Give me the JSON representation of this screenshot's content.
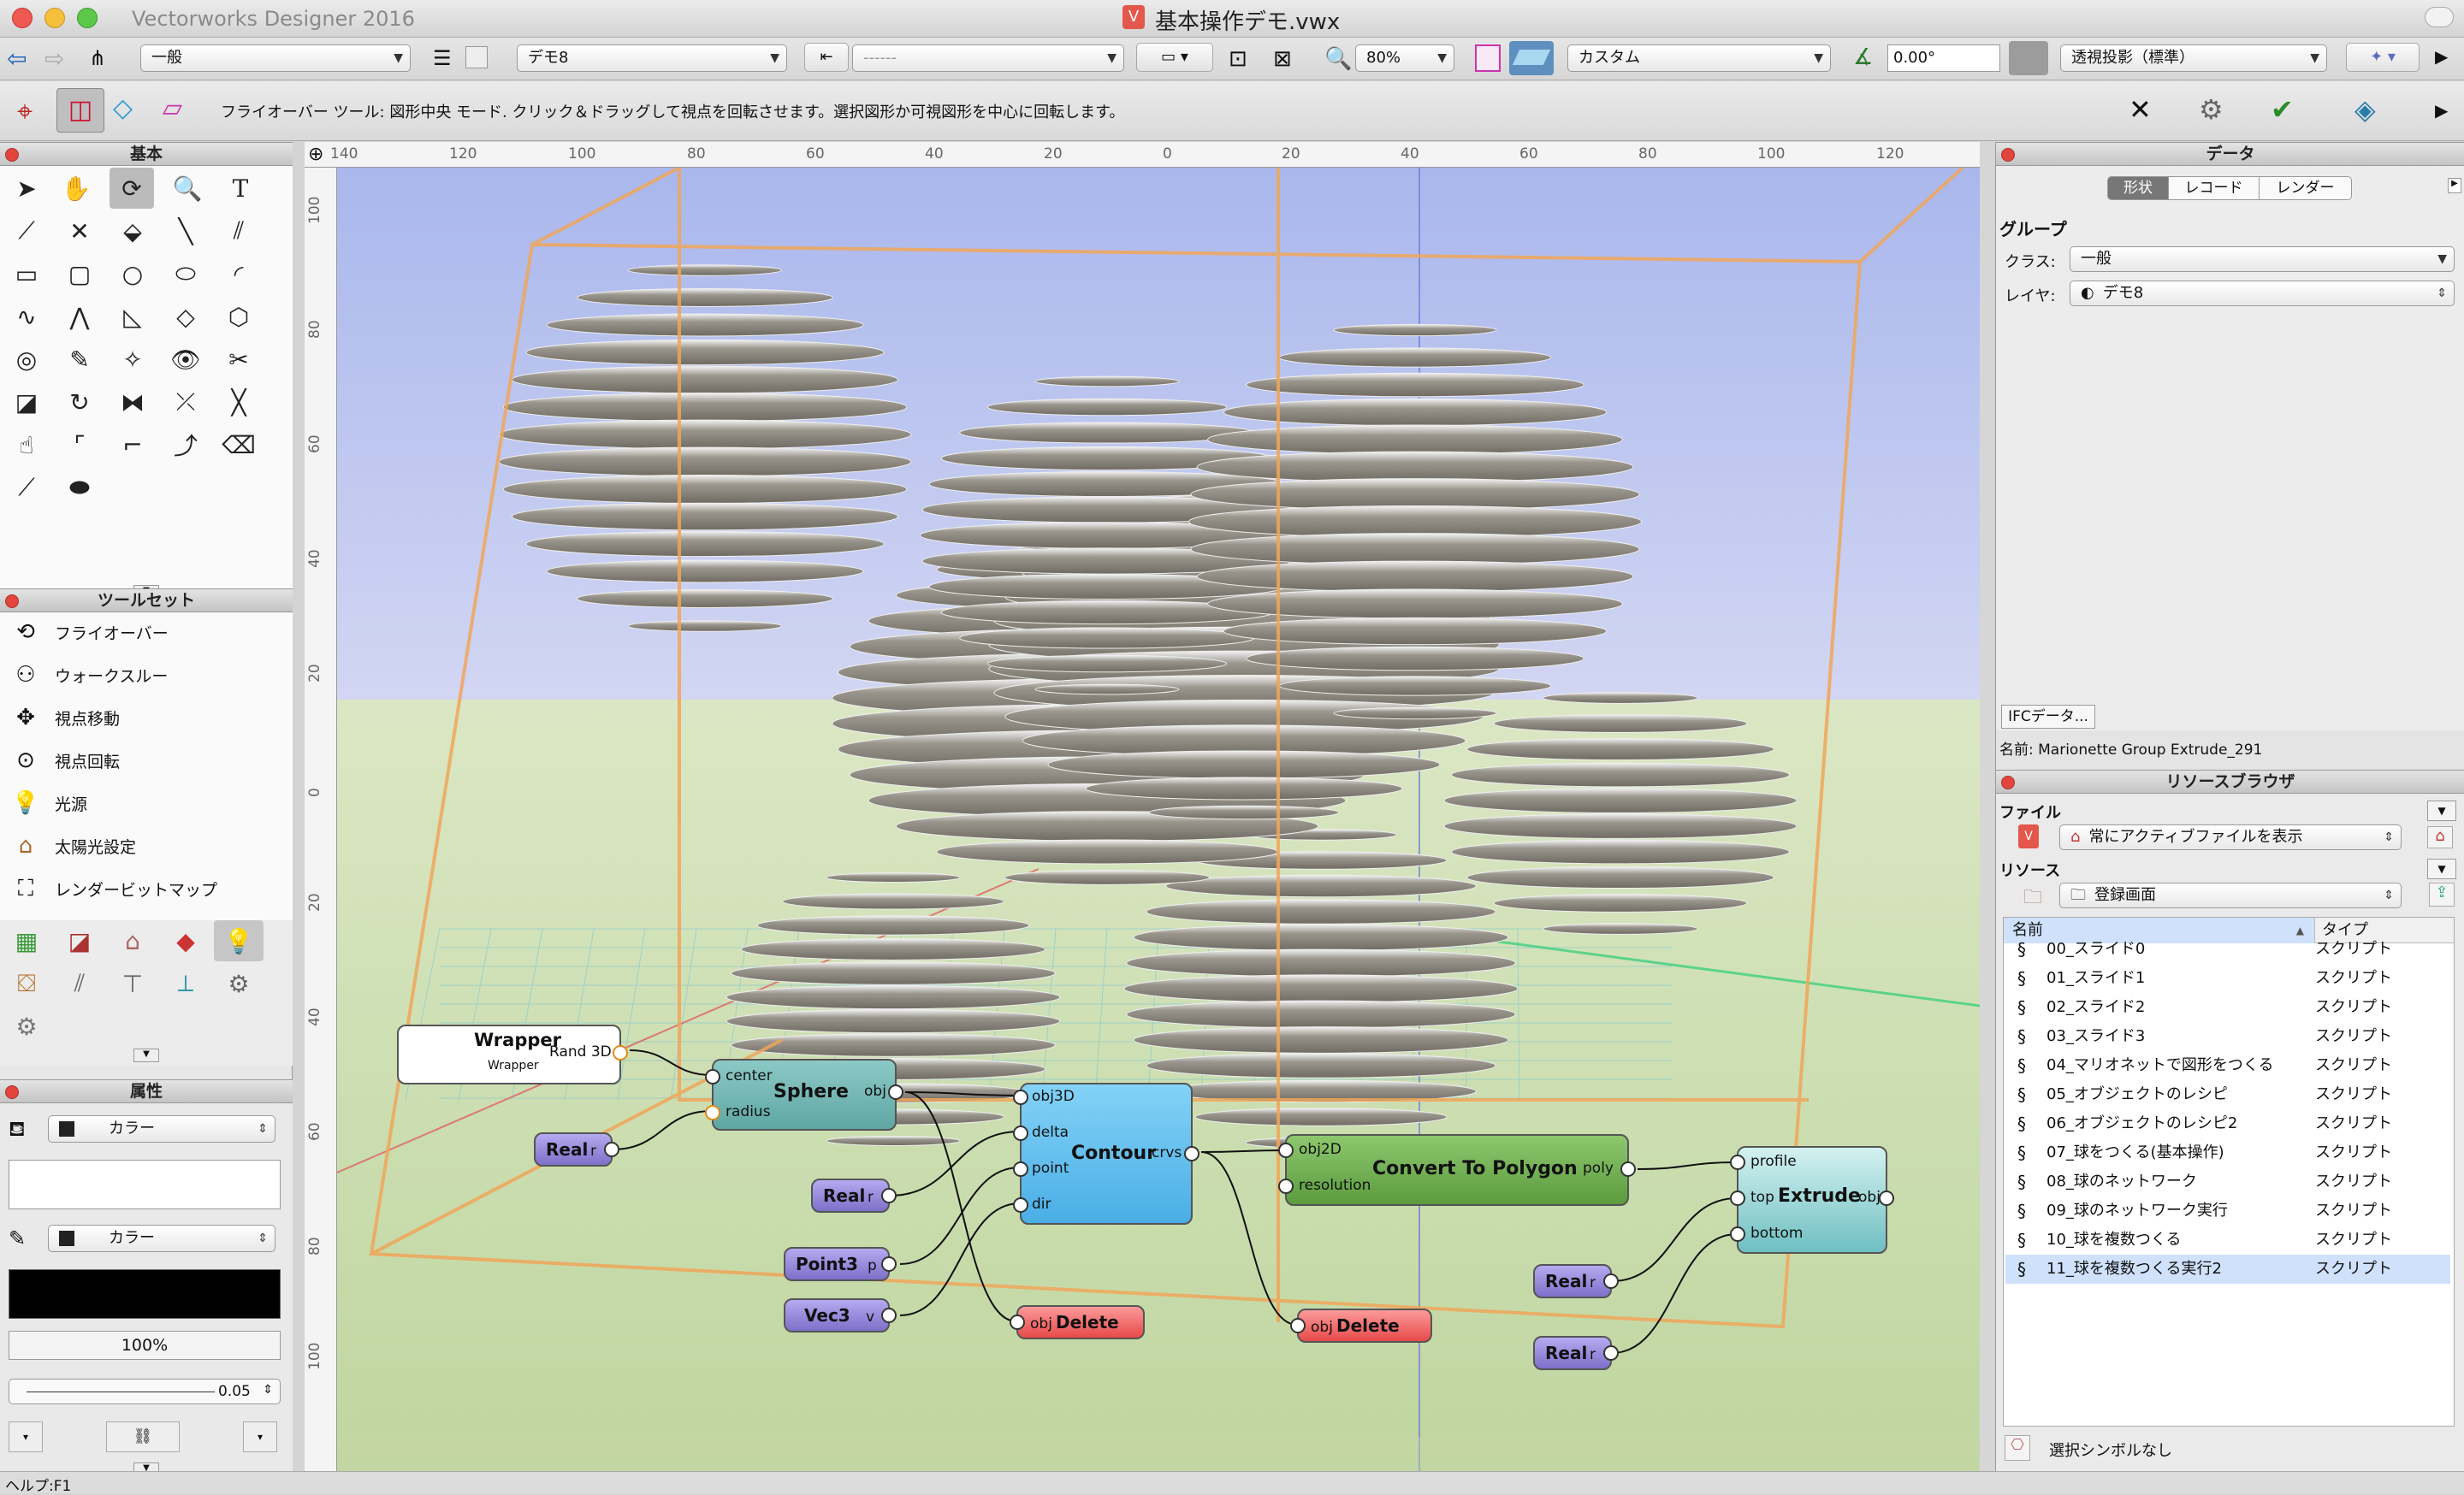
{
  "app_title": "Vectorworks Designer 2016",
  "doc_title": "基本操作デモ.vwx",
  "toolbar1": {
    "class_value": "一般",
    "layer_value": "デモ8",
    "dash_value": "------",
    "zoom": "80%",
    "render_value": "カスタム",
    "angle": "0.00°",
    "view_value": "透視投影（標準）"
  },
  "mode_hint": "フライオーバー ツール: 図形中央 モード. クリック＆ドラッグして視点を回転させます。選択図形か可視図形を中心に回転します。",
  "panels": {
    "basic": "基本",
    "toolset": "ツールセット",
    "attributes": "属性",
    "data": "データ",
    "resource": "リソースブラウザ"
  },
  "toolset_items": [
    "フライオーバー",
    "ウォークスルー",
    "視点移動",
    "視点回転",
    "光源",
    "太陽光設定",
    "レンダービットマップ"
  ],
  "attributes": {
    "fill": "カラー",
    "pen": "カラー",
    "opacity": "100%",
    "line": "0.05"
  },
  "data": {
    "tabs": [
      "形状",
      "レコード",
      "レンダー"
    ],
    "heading": "グループ",
    "class_label": "クラス:",
    "class_value": "一般",
    "layer_label": "レイヤ:",
    "layer_value": "デモ8",
    "ifc_button": "IFCデータ...",
    "name_line": "名前: Marionette Group Extrude_291"
  },
  "resource": {
    "file_label": "ファイル",
    "file_value": "常にアクティブファイルを表示",
    "res_label": "リソース",
    "res_value": "登録画面",
    "col_name": "名前",
    "col_type": "タイプ",
    "rows": [
      {
        "name": "00_スライド0",
        "type": "スクリプト"
      },
      {
        "name": "01_スライド1",
        "type": "スクリプト"
      },
      {
        "name": "02_スライド2",
        "type": "スクリプト"
      },
      {
        "name": "03_スライド3",
        "type": "スクリプト"
      },
      {
        "name": "04_マリオネットで図形をつくる",
        "type": "スクリプト"
      },
      {
        "name": "05_オブジェクトのレシピ",
        "type": "スクリプト"
      },
      {
        "name": "06_オブジェクトのレシピ2",
        "type": "スクリプト"
      },
      {
        "name": "07_球をつくる(基本操作)",
        "type": "スクリプト"
      },
      {
        "name": "08_球のネットワーク",
        "type": "スクリプト"
      },
      {
        "name": "09_球のネットワーク実行",
        "type": "スクリプト"
      },
      {
        "name": "10_球を複数つくる",
        "type": "スクリプト"
      },
      {
        "name": "11_球を複数つくる実行2",
        "type": "スクリプト"
      }
    ],
    "footer": "選択シンボルなし"
  },
  "ruler_top": [
    "140",
    "120",
    "100",
    "80",
    "60",
    "40",
    "20",
    "0",
    "20",
    "40",
    "60",
    "80",
    "100",
    "120"
  ],
  "ruler_left": [
    "100",
    "80",
    "60",
    "40",
    "20",
    "0",
    "20",
    "40",
    "60",
    "80",
    "100"
  ],
  "nodes": {
    "wrapper": {
      "title": "Wrapper",
      "sub": "Wrapper",
      "out": "Rand 3D"
    },
    "sphere": {
      "title": "Sphere",
      "in1": "center",
      "in2": "radius",
      "out": "obj"
    },
    "contour": {
      "title": "Contour",
      "in1": "obj3D",
      "in2": "delta",
      "in3": "point",
      "in4": "dir",
      "out": "crvs"
    },
    "convert": {
      "title": "Convert To Polygon",
      "in1": "obj2D",
      "in2": "resolution",
      "out": "poly"
    },
    "extrude": {
      "title": "Extrude",
      "in1": "profile",
      "in2": "top",
      "in3": "bottom",
      "out": "obj"
    },
    "real1": {
      "title": "Real",
      "out": "r"
    },
    "real2": {
      "title": "Real",
      "out": "r"
    },
    "real3": {
      "title": "Real",
      "out": "r"
    },
    "real4": {
      "title": "Real",
      "out": "r"
    },
    "point3": {
      "title": "Point3",
      "out": "p"
    },
    "vec3": {
      "title": "Vec3",
      "out": "v"
    },
    "delete1": {
      "title": "Delete",
      "in": "obj"
    },
    "delete2": {
      "title": "Delete",
      "in": "obj"
    }
  },
  "status": "ヘルプ:F1"
}
